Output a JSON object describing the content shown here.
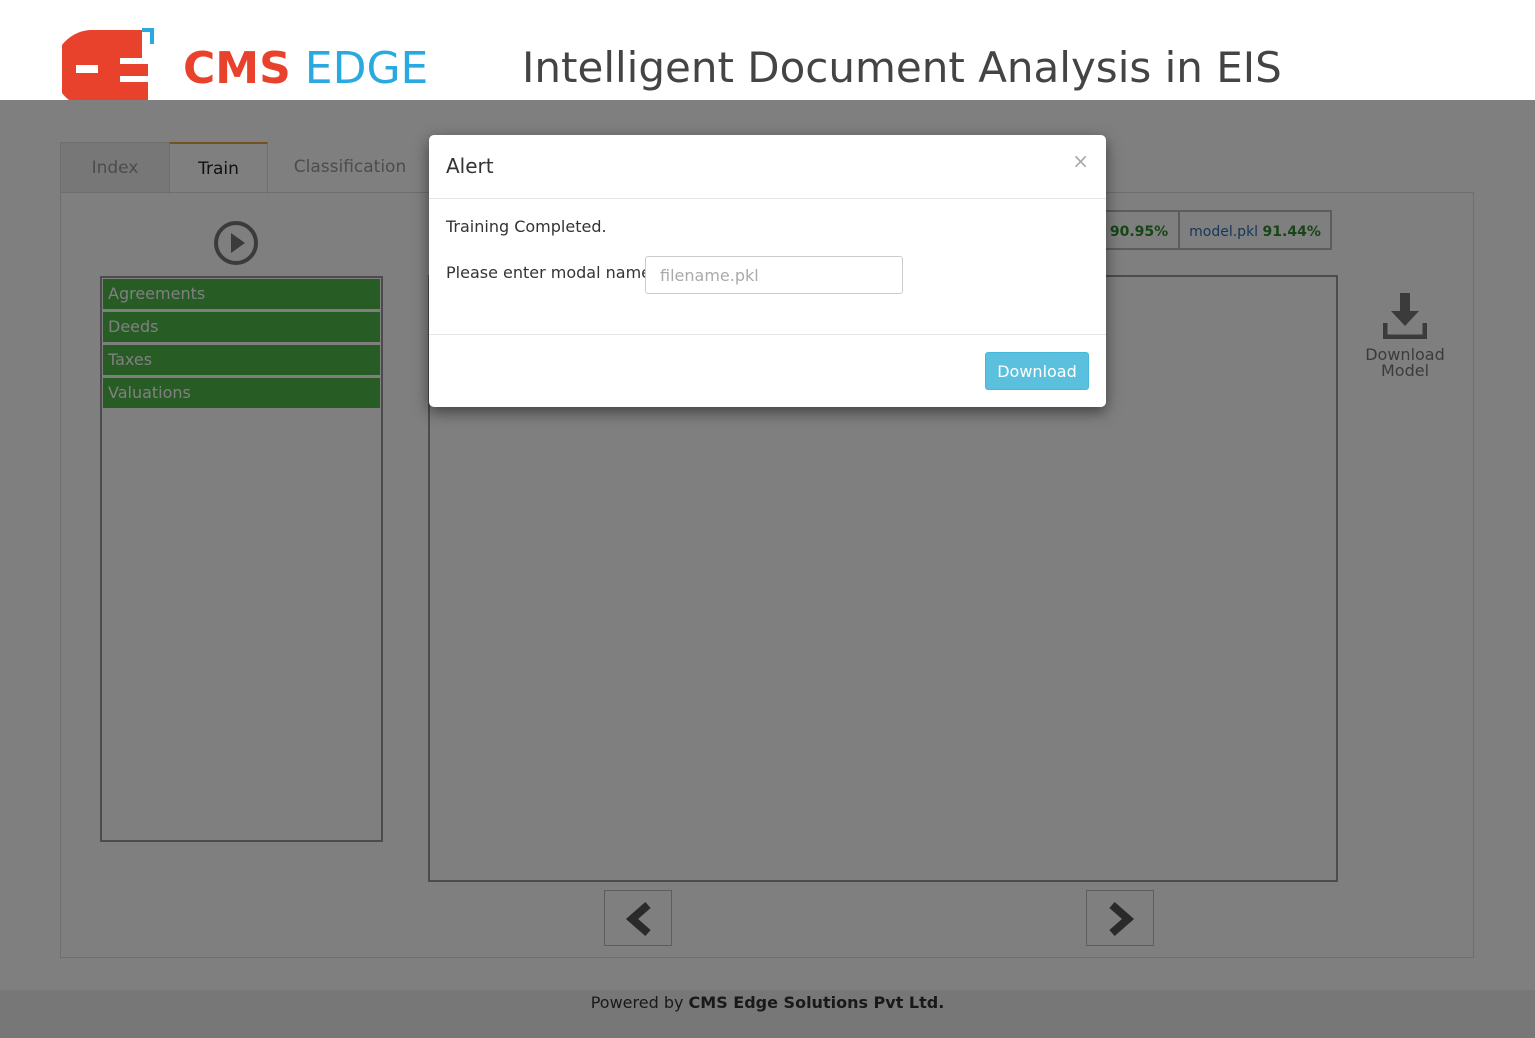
{
  "header": {
    "logo_part1": "CMS",
    "logo_part2": "EDGE",
    "title": "Intelligent Document Analysis in EIS"
  },
  "tabs": [
    {
      "label": "Index"
    },
    {
      "label": "Train"
    },
    {
      "label": "Classification"
    }
  ],
  "categories": [
    {
      "label": "Agreements"
    },
    {
      "label": "Deeds"
    },
    {
      "label": "Taxes"
    },
    {
      "label": "Valuations"
    }
  ],
  "models": [
    {
      "name": "",
      "accuracy": "90.95%"
    },
    {
      "name": "model.pkl",
      "accuracy": "91.44%"
    }
  ],
  "download_model_label": "Download Model",
  "footer": {
    "prefix": "Powered by",
    "company": "CMS Edge Solutions Pvt Ltd."
  },
  "modal": {
    "title": "Alert",
    "close": "×",
    "message": "Training Completed.",
    "field_label": "Please enter modal name :",
    "field_placeholder": "filename.pkl",
    "field_value": "",
    "button": "Download"
  },
  "colors": {
    "brand_red": "#e8412c",
    "brand_blue": "#29a9e0",
    "category_green": "#4fb84a",
    "accuracy_green": "#2e8b2e",
    "button_info": "#5bc0de",
    "active_tab_accent": "#e8a23a"
  },
  "icons": [
    "cms-edge-logo-icon",
    "play-circle-icon",
    "download-icon",
    "chevron-left-icon",
    "chevron-right-icon",
    "close-icon"
  ]
}
